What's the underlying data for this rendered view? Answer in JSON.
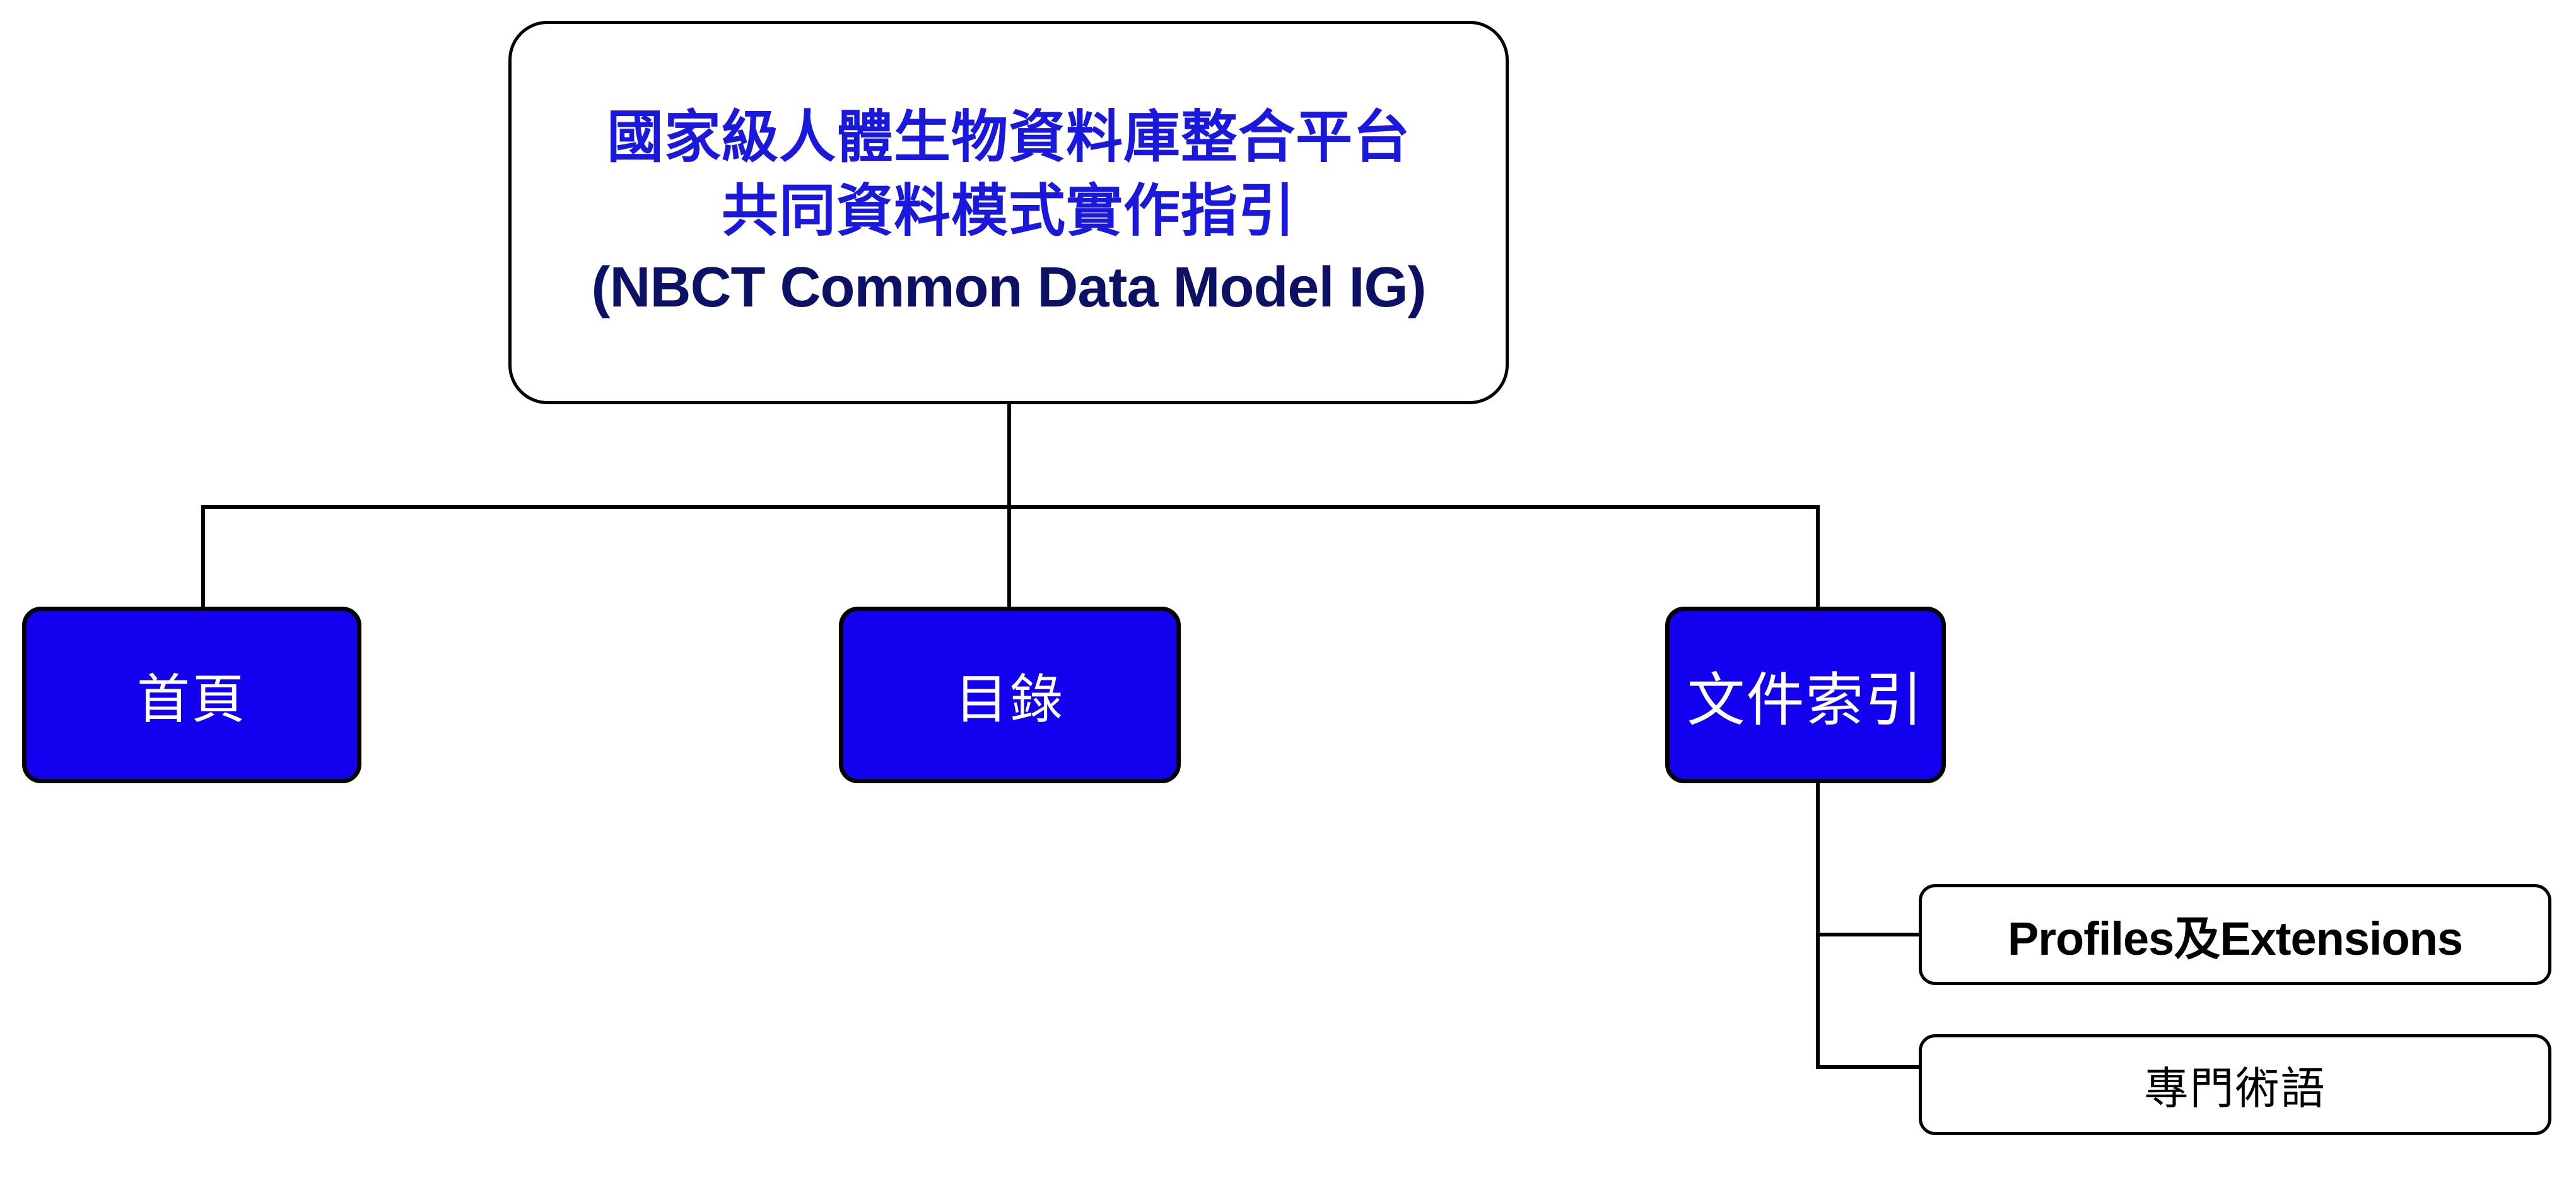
{
  "diagram": {
    "type": "site-map-tree",
    "background_color": "#ffffff",
    "root": {
      "title_lines_cjk": [
        "國家級人體生物資料庫整合平台",
        "共同資料模式實作指引"
      ],
      "title_line_en": "(NBCT Common Data Model IG)",
      "cjk_color": "#1a18dd",
      "en_color": "#0d1166",
      "fill_color": "#ffffff",
      "border_color": "#000000"
    },
    "nav_nodes": [
      {
        "label": "首頁",
        "fill_color": "#1200ee",
        "text_color": "#ffffff"
      },
      {
        "label": "目錄",
        "fill_color": "#1200ee",
        "text_color": "#ffffff"
      },
      {
        "label": "文件索引",
        "fill_color": "#1200ee",
        "text_color": "#ffffff"
      }
    ],
    "leaf_nodes": [
      {
        "label": "Profiles及Extensions",
        "fill_color": "#ffffff",
        "text_color": "#000000"
      },
      {
        "label": "專門術語",
        "fill_color": "#ffffff",
        "text_color": "#000000"
      }
    ],
    "connector_color": "#000000"
  }
}
